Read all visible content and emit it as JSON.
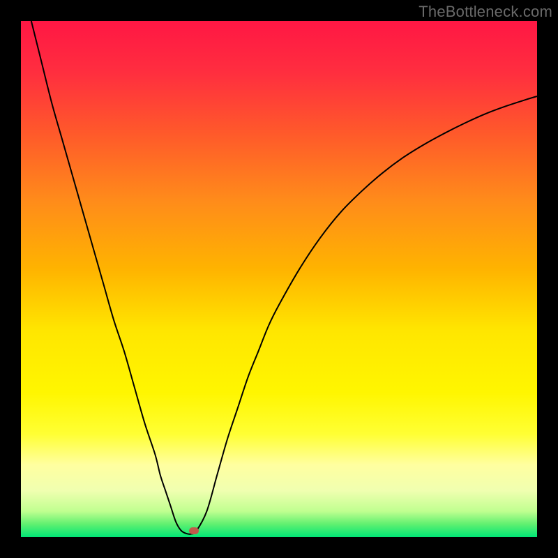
{
  "watermark": "TheBottleneck.com",
  "colors": {
    "frame_bg": "#000000",
    "watermark": "#6a6a6a",
    "curve": "#000000",
    "marker": "#c05a4a"
  },
  "gradient_stops": [
    {
      "offset": 0.0,
      "color": "#ff1744"
    },
    {
      "offset": 0.1,
      "color": "#ff2e3f"
    },
    {
      "offset": 0.22,
      "color": "#ff5a2a"
    },
    {
      "offset": 0.35,
      "color": "#ff8c1a"
    },
    {
      "offset": 0.48,
      "color": "#ffb300"
    },
    {
      "offset": 0.6,
      "color": "#ffe600"
    },
    {
      "offset": 0.72,
      "color": "#fff600"
    },
    {
      "offset": 0.8,
      "color": "#ffff33"
    },
    {
      "offset": 0.86,
      "color": "#ffffa0"
    },
    {
      "offset": 0.91,
      "color": "#f0ffb0"
    },
    {
      "offset": 0.95,
      "color": "#c0ff90"
    },
    {
      "offset": 0.975,
      "color": "#60f070"
    },
    {
      "offset": 1.0,
      "color": "#00e676"
    }
  ],
  "chart_data": {
    "type": "line",
    "title": "",
    "xlabel": "",
    "ylabel": "",
    "xlim": [
      0,
      100
    ],
    "ylim": [
      0,
      100
    ],
    "grid": false,
    "series": [
      {
        "name": "curve",
        "x": [
          2,
          4,
          6,
          8,
          10,
          12,
          14,
          16,
          18,
          20,
          22,
          24,
          26,
          27,
          28,
          29,
          30,
          31,
          32,
          33,
          34,
          36,
          38,
          40,
          42,
          44,
          46,
          48,
          50,
          54,
          58,
          62,
          66,
          70,
          74,
          78,
          82,
          86,
          90,
          94,
          98,
          100
        ],
        "y": [
          100,
          92,
          84,
          77,
          70,
          63,
          56,
          49,
          42,
          36,
          29,
          22,
          16,
          12,
          9,
          6,
          3,
          1.3,
          0.7,
          0.6,
          1.2,
          5,
          12,
          19,
          25,
          31,
          36,
          41,
          45,
          52,
          58,
          63,
          67,
          70.5,
          73.5,
          76,
          78.2,
          80.2,
          82,
          83.5,
          84.8,
          85.4
        ]
      }
    ],
    "marker": {
      "x": 33.5,
      "y": 1.2
    }
  }
}
